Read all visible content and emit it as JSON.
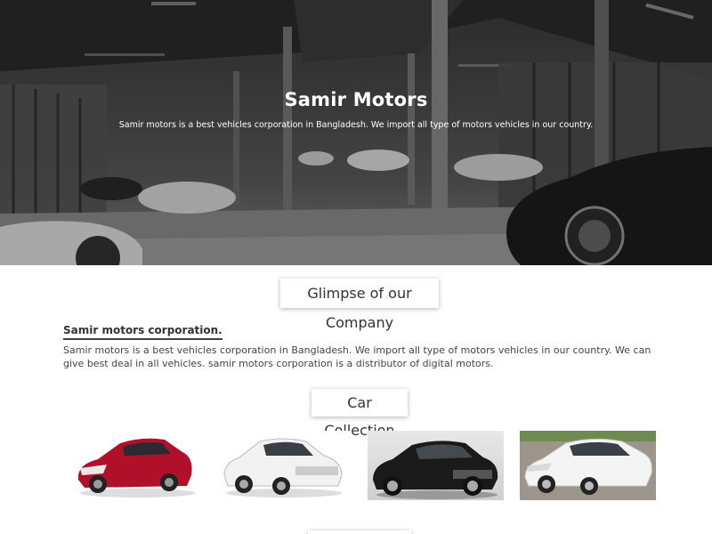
{
  "hero": {
    "title": "Samir Motors",
    "subtitle": "Samir motors is a best vehicles corporation in Bangladesh. We import all type of motors vehicles in our country."
  },
  "glimpse": {
    "title": "Glimpse of our Company",
    "heading": "Samir motors corporation.",
    "text": "Samir motors is a best vehicles corporation in Bangladesh. We import all type of motors vehicles in our country. We can give best deal in all vehicles. samir motors corporation is a distributor of digital motors."
  },
  "collection": {
    "title": "Car Collection",
    "cars": [
      {
        "icon": "red-car-image",
        "color": "#b0102a"
      },
      {
        "icon": "white-car-image",
        "color": "#f2f2f2"
      },
      {
        "icon": "black-car-image",
        "color": "#1a1a1a"
      },
      {
        "icon": "white-sedan-image",
        "color": "#f4f4f4"
      }
    ]
  }
}
